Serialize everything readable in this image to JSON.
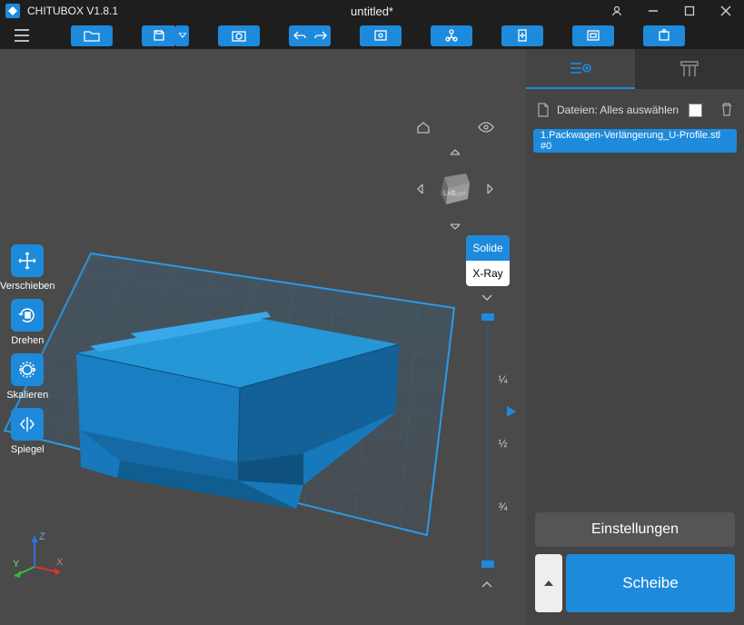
{
  "app": {
    "name": "CHITUBOX V1.8.1",
    "doc": "untitled*"
  },
  "toolbar": {
    "buttons": [
      "open",
      "save",
      "screenshot",
      "undo",
      "redo",
      "box",
      "hierarchy",
      "add",
      "hollow",
      "trash"
    ]
  },
  "left_tools": [
    {
      "name": "move",
      "label": "Verschieben"
    },
    {
      "name": "rotate",
      "label": "Drehen"
    },
    {
      "name": "scale",
      "label": "Skalieren"
    },
    {
      "name": "mirror",
      "label": "Spiegel"
    }
  ],
  "view_mode": {
    "solid": "Solide",
    "xray": "X-Ray"
  },
  "slider": {
    "q1": "¼",
    "q2": "½",
    "q3": "¾"
  },
  "side": {
    "files_label": "Dateien: Alles auswählen",
    "file_item": "1.Packwagen-Verlängerung_U-Profile.stl #0",
    "settings": "Einstellungen",
    "slice": "Scheibe"
  },
  "cube": {
    "left": "Left",
    "front": "Front"
  },
  "axes": {
    "x": "X",
    "y": "Y",
    "z": "Z"
  }
}
